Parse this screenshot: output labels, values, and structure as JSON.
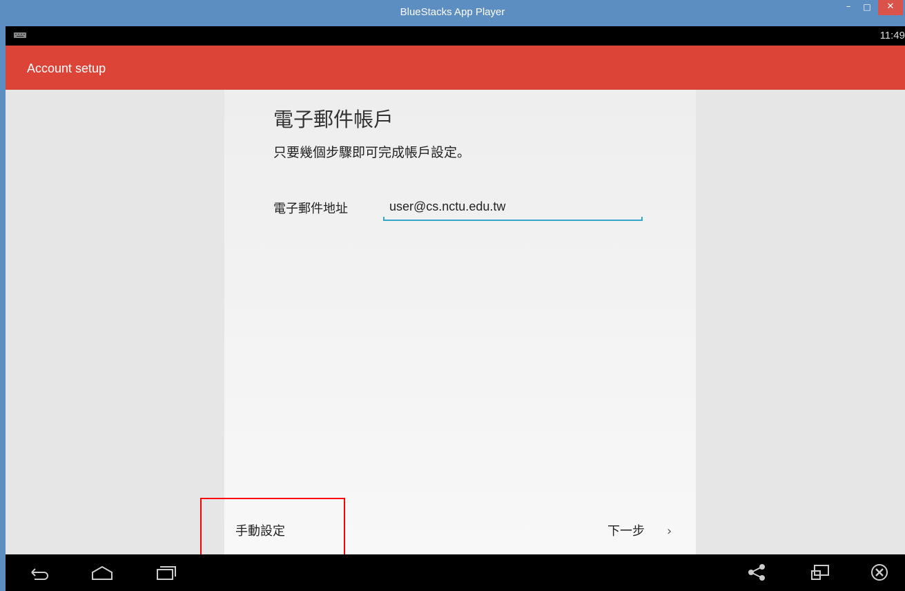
{
  "window": {
    "title": "BlueStacks App Player",
    "min_glyph": "–",
    "max_glyph": "□",
    "close_glyph": "✕"
  },
  "status_bar": {
    "time": "11:49"
  },
  "action_bar": {
    "title": "Account setup",
    "color": "#db4437"
  },
  "form": {
    "heading": "電子郵件帳戶",
    "subheading": "只要幾個步驟即可完成帳戶設定。",
    "email_label": "電子郵件地址",
    "email_value": "user@cs.nctu.edu.tw",
    "accent_color": "#33a5c8"
  },
  "footer": {
    "manual_setup_label": "手動設定",
    "next_label": "下一步",
    "next_chevron": "›"
  },
  "nav_bar": {
    "icons": [
      "back-icon",
      "home-icon",
      "recents-icon",
      "share-icon",
      "window-icon",
      "close-circle-icon"
    ]
  }
}
